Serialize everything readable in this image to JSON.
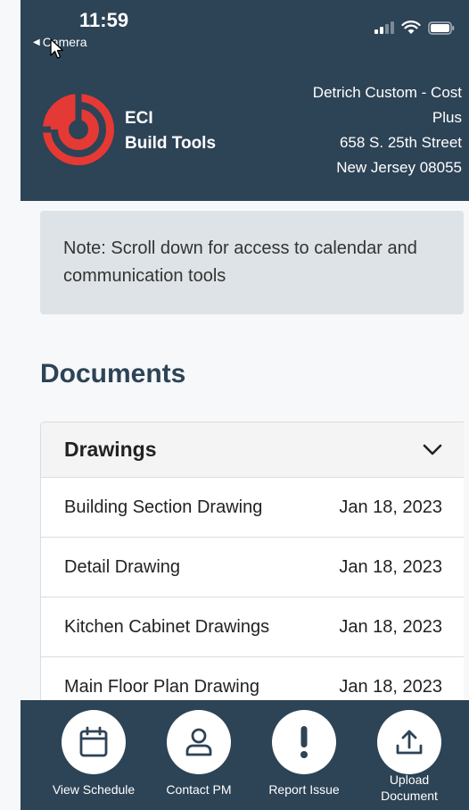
{
  "status": {
    "time": "11:59",
    "back_label": "Camera"
  },
  "header": {
    "app_name_line1": "ECI",
    "app_name_line2": "Build Tools",
    "address_line1": "Detrich Custom - Cost",
    "address_line2": "Plus",
    "address_line3": "658 S. 25th Street",
    "address_line4": "New Jersey 08055"
  },
  "note": {
    "text": "Note: Scroll down for access to calendar and communication tools"
  },
  "documents": {
    "title": "Documents",
    "category": "Drawings",
    "rows": [
      {
        "name": "Building Section Drawing",
        "date": "Jan 18, 2023"
      },
      {
        "name": "Detail Drawing",
        "date": "Jan 18, 2023"
      },
      {
        "name": "Kitchen Cabinet Drawings",
        "date": "Jan 18, 2023"
      },
      {
        "name": "Main Floor Plan Drawing",
        "date": "Jan 18, 2023"
      }
    ]
  },
  "bottom_nav": [
    {
      "label": "View Schedule",
      "icon": "calendar-icon"
    },
    {
      "label": "Contact PM",
      "icon": "person-icon"
    },
    {
      "label": "Report Issue",
      "icon": "exclamation-icon"
    },
    {
      "label": "Upload Document",
      "icon": "upload-icon"
    }
  ],
  "colors": {
    "header_bg": "#2d4356",
    "accent_red": "#e53935",
    "note_bg": "#dde3e6"
  }
}
